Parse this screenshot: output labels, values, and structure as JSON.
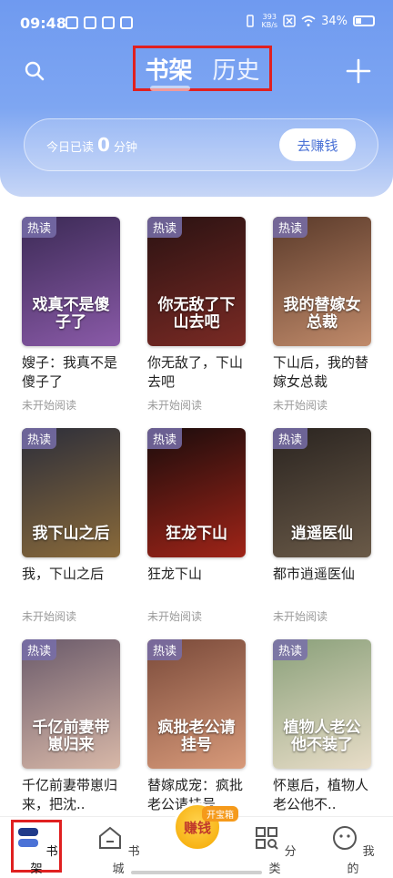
{
  "status_bar": {
    "time": "09:48",
    "net_speed_value": "393",
    "net_speed_unit": "KB/s",
    "battery": "34%"
  },
  "header": {
    "tabs": [
      {
        "label": "书架",
        "active": true
      },
      {
        "label": "历史",
        "active": false
      }
    ],
    "search_icon": "search-icon",
    "add_icon": "plus-icon"
  },
  "reading": {
    "prefix": "今日已读",
    "minutes": "0",
    "suffix": "分钟",
    "earn_button": "去赚钱"
  },
  "books": [
    {
      "badge": "热读",
      "cover_text": "戏真不是傻子了",
      "title": "嫂子：我真不是傻子了",
      "status": "未开始阅读",
      "colors": [
        "#3b2a55",
        "#8a5aa8"
      ]
    },
    {
      "badge": "热读",
      "cover_text": "你无敌了下山去吧",
      "title": "你无敌了，下山去吧",
      "status": "未开始阅读",
      "colors": [
        "#2a1212",
        "#7a2a24"
      ]
    },
    {
      "badge": "热读",
      "cover_text": "我的替嫁女总裁",
      "title": "下山后，我的替嫁女总裁",
      "status": "未开始阅读",
      "colors": [
        "#5a3a2a",
        "#c08a6a"
      ]
    },
    {
      "badge": "热读",
      "cover_text": "我下山之后",
      "title": "我，下山之后",
      "status": "未开始阅读",
      "colors": [
        "#2c2e3a",
        "#8a6a3a"
      ]
    },
    {
      "badge": "热读",
      "cover_text": "狂龙下山",
      "title": "狂龙下山",
      "status": "未开始阅读",
      "colors": [
        "#1a0c0c",
        "#a02418"
      ]
    },
    {
      "badge": "热读",
      "cover_text": "逍遥医仙",
      "title": "都市逍遥医仙",
      "status": "未开始阅读",
      "colors": [
        "#2a2420",
        "#6a5a48"
      ]
    },
    {
      "badge": "热读",
      "cover_text": "千亿前妻带崽归来",
      "title": "千亿前妻带崽归来，把沈..",
      "status": "",
      "colors": [
        "#6a5a6a",
        "#d8b8a8"
      ]
    },
    {
      "badge": "热读",
      "cover_text": "疯批老公请挂号",
      "title": "替嫁成宠：疯批老公请挂号",
      "status": "",
      "colors": [
        "#7a4a3a",
        "#d89a7a"
      ]
    },
    {
      "badge": "热读",
      "cover_text": "植物人老公他不装了",
      "title": "怀崽后，植物人老公他不..",
      "status": "",
      "colors": [
        "#8aa07a",
        "#e8ddc8"
      ]
    }
  ],
  "bottom_nav": {
    "items": [
      {
        "label": "书架",
        "icon": "bookshelf-icon"
      },
      {
        "label": "书城",
        "icon": "store-icon"
      },
      {
        "label": "赚钱",
        "icon": "coin-icon"
      },
      {
        "label": "分类",
        "icon": "category-icon"
      },
      {
        "label": "我的",
        "icon": "profile-icon"
      }
    ],
    "chest_tag": "开宝箱"
  },
  "colors": {
    "accent": "#4b72d6",
    "header_top": "#6f9af0",
    "highlight_box": "#e02020"
  }
}
